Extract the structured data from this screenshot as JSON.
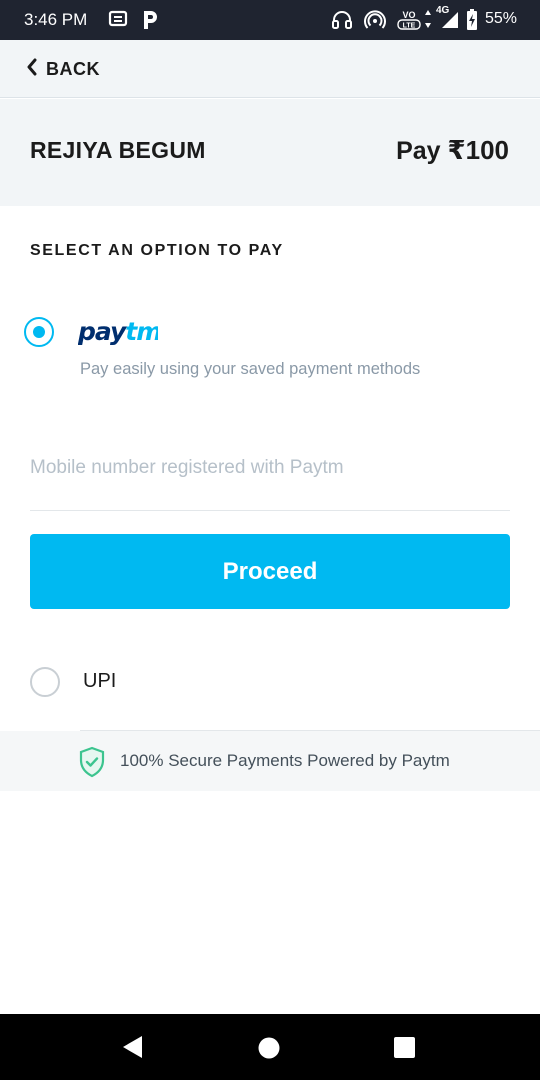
{
  "status_bar": {
    "time": "3:46 PM",
    "battery": "55%",
    "network": "4G",
    "volte": "VoLTE",
    "icons": [
      "message-icon",
      "parking-icon",
      "headset-icon",
      "hotspot-icon",
      "volte-icon",
      "signal-icon",
      "battery-icon"
    ]
  },
  "header": {
    "back_label": "BACK"
  },
  "payee": {
    "name": "REJIYA BEGUM",
    "pay_prefix": "Pay ",
    "amount": "₹100"
  },
  "section": {
    "title": "SELECT AN OPTION TO PAY"
  },
  "paytm_option": {
    "brand": "paytm",
    "description": "Pay easily using your saved payment methods",
    "selected": true
  },
  "mobile_field": {
    "placeholder": "Mobile number registered with Paytm",
    "value": ""
  },
  "proceed": {
    "label": "Proceed"
  },
  "upi_option": {
    "label": "UPI",
    "selected": false
  },
  "footer": {
    "secure_text": "100% Secure Payments Powered by Paytm"
  },
  "colors": {
    "accent": "#00b9f1",
    "paytm_navy": "#002e6e",
    "shield_green": "#3cc48f",
    "status_bar": "#1f2430"
  }
}
